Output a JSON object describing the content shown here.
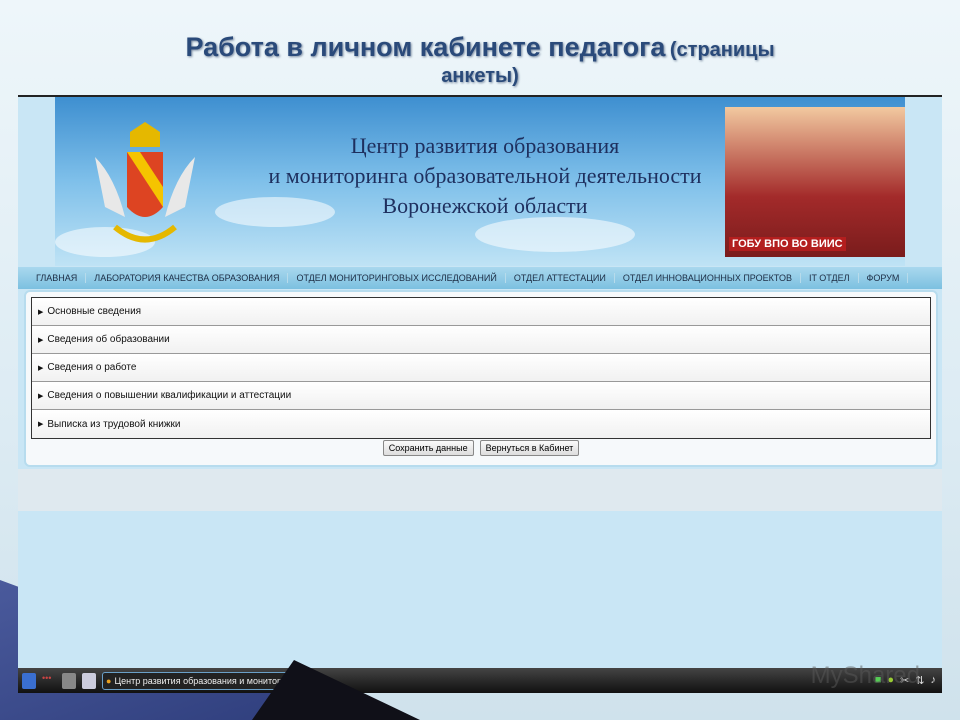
{
  "slide": {
    "title_main": "Работа в личном кабинете педагога",
    "title_sub1": "(страницы",
    "title_sub2": "анкеты)"
  },
  "banner": {
    "line1": "Центр развития образования",
    "line2": "и мониторинга образовательной деятельности",
    "line3": "Воронежской области",
    "badge": "ГОБУ ВПО ВО ВИИС"
  },
  "nav": [
    "ГЛАВНАЯ",
    "ЛАБОРАТОРИЯ КАЧЕСТВА ОБРАЗОВАНИЯ",
    "ОТДЕЛ МОНИТОРИНГОВЫХ ИССЛЕДОВАНИЙ",
    "ОТДЕЛ АТТЕСТАЦИИ",
    "ОТДЕЛ ИННОВАЦИОННЫХ ПРОЕКТОВ",
    "IT ОТДЕЛ",
    "ФОРУМ"
  ],
  "sections": [
    "Основные сведения",
    "Сведения об образовании",
    "Сведения о работе",
    "Сведения о повышении квалификации и аттестации",
    "Выписка из трудовой книжки"
  ],
  "buttons": {
    "save": "Сохранить данные",
    "back": "Вернуться в Кабинет"
  },
  "taskbar": {
    "window": "Центр развития образования и мониторинга"
  },
  "watermark": "MyShared"
}
